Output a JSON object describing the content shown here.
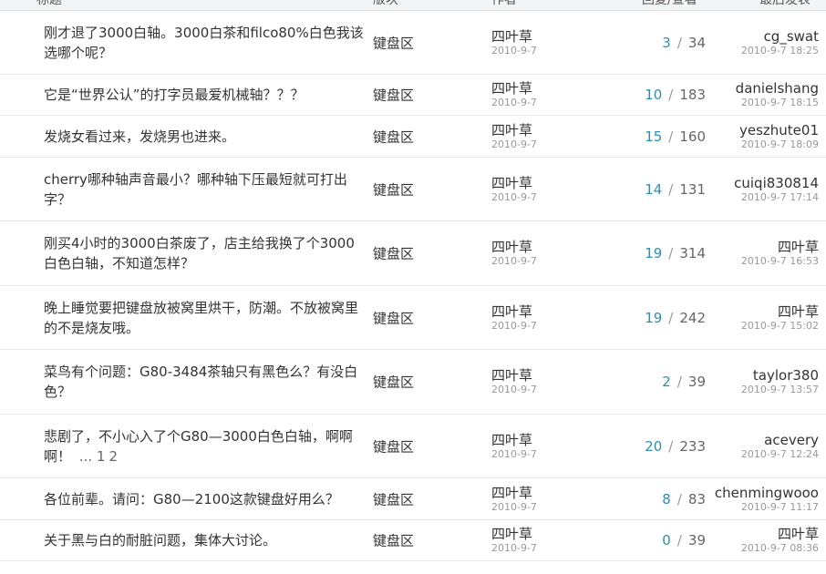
{
  "header": {
    "title_col": "标题",
    "board_col": "版块",
    "author_col": "作者",
    "stats_col": "回复/查看",
    "last_col": "最后发表"
  },
  "threads": [
    {
      "title": "刚才退了3000白轴。3000白茶和filco80%白色我该选哪个呢？",
      "board": "键盘区",
      "author": "四叶草",
      "date": "2010-9-7",
      "replies": "3",
      "views": "34",
      "last_user": "cg_swat",
      "last_time": "2010-9-7 18:25"
    },
    {
      "title": "它是“世界公认”的打字员最爱机械轴？？？",
      "board": "键盘区",
      "author": "四叶草",
      "date": "2010-9-7",
      "replies": "10",
      "views": "183",
      "last_user": "danielshang",
      "last_time": "2010-9-7 18:15"
    },
    {
      "title": "发烧女看过来，发烧男也进来。",
      "board": "键盘区",
      "author": "四叶草",
      "date": "2010-9-7",
      "replies": "15",
      "views": "160",
      "last_user": "yeszhute01",
      "last_time": "2010-9-7 18:09"
    },
    {
      "title": "cherry哪种轴声音最小？哪种轴下压最短就可打出字？",
      "board": "键盘区",
      "author": "四叶草",
      "date": "2010-9-7",
      "replies": "14",
      "views": "131",
      "last_user": "cuiqi830814",
      "last_time": "2010-9-7 17:14"
    },
    {
      "title": "刚买4小时的3000白茶废了，店主给我换了个3000白色白轴，不知道怎样？",
      "board": "键盘区",
      "author": "四叶草",
      "date": "2010-9-7",
      "replies": "19",
      "views": "314",
      "last_user": "四叶草",
      "last_time": "2010-9-7 16:53"
    },
    {
      "title": "晚上睡觉要把键盘放被窝里烘干，防潮。不放被窝里的不是烧友哦。",
      "board": "键盘区",
      "author": "四叶草",
      "date": "2010-9-7",
      "replies": "19",
      "views": "242",
      "last_user": "四叶草",
      "last_time": "2010-9-7 15:02"
    },
    {
      "title": "菜鸟有个问题：G80-3484茶轴只有黑色么？有没白色？",
      "board": "键盘区",
      "author": "四叶草",
      "date": "2010-9-7",
      "replies": "2",
      "views": "39",
      "last_user": "taylor380",
      "last_time": "2010-9-7 13:57"
    },
    {
      "title": "悲剧了，不小心入了个G80—3000白色白轴，啊啊啊！",
      "pages_prefix": "...",
      "pages": [
        "1",
        "2"
      ],
      "board": "键盘区",
      "author": "四叶草",
      "date": "2010-9-7",
      "replies": "20",
      "views": "233",
      "last_user": "acevery",
      "last_time": "2010-9-7 12:24"
    },
    {
      "title": "各位前辈。请问：G80—2100这款键盘好用么？",
      "board": "键盘区",
      "author": "四叶草",
      "date": "2010-9-7",
      "replies": "8",
      "views": "83",
      "last_user": "chenmingwooo",
      "last_time": "2010-9-7 11:17"
    },
    {
      "title": "关于黑与白的耐脏问题，集体大讨论。",
      "board": "键盘区",
      "author": "四叶草",
      "date": "2010-9-7",
      "replies": "0",
      "views": "39",
      "last_user": "四叶草",
      "last_time": "2010-9-7 08:36"
    }
  ],
  "colors": {
    "reply_count": "#2b8fb8",
    "date_gray": "#999999",
    "row_border": "#e4e8ec",
    "header_bg": "#f3f6f8"
  }
}
